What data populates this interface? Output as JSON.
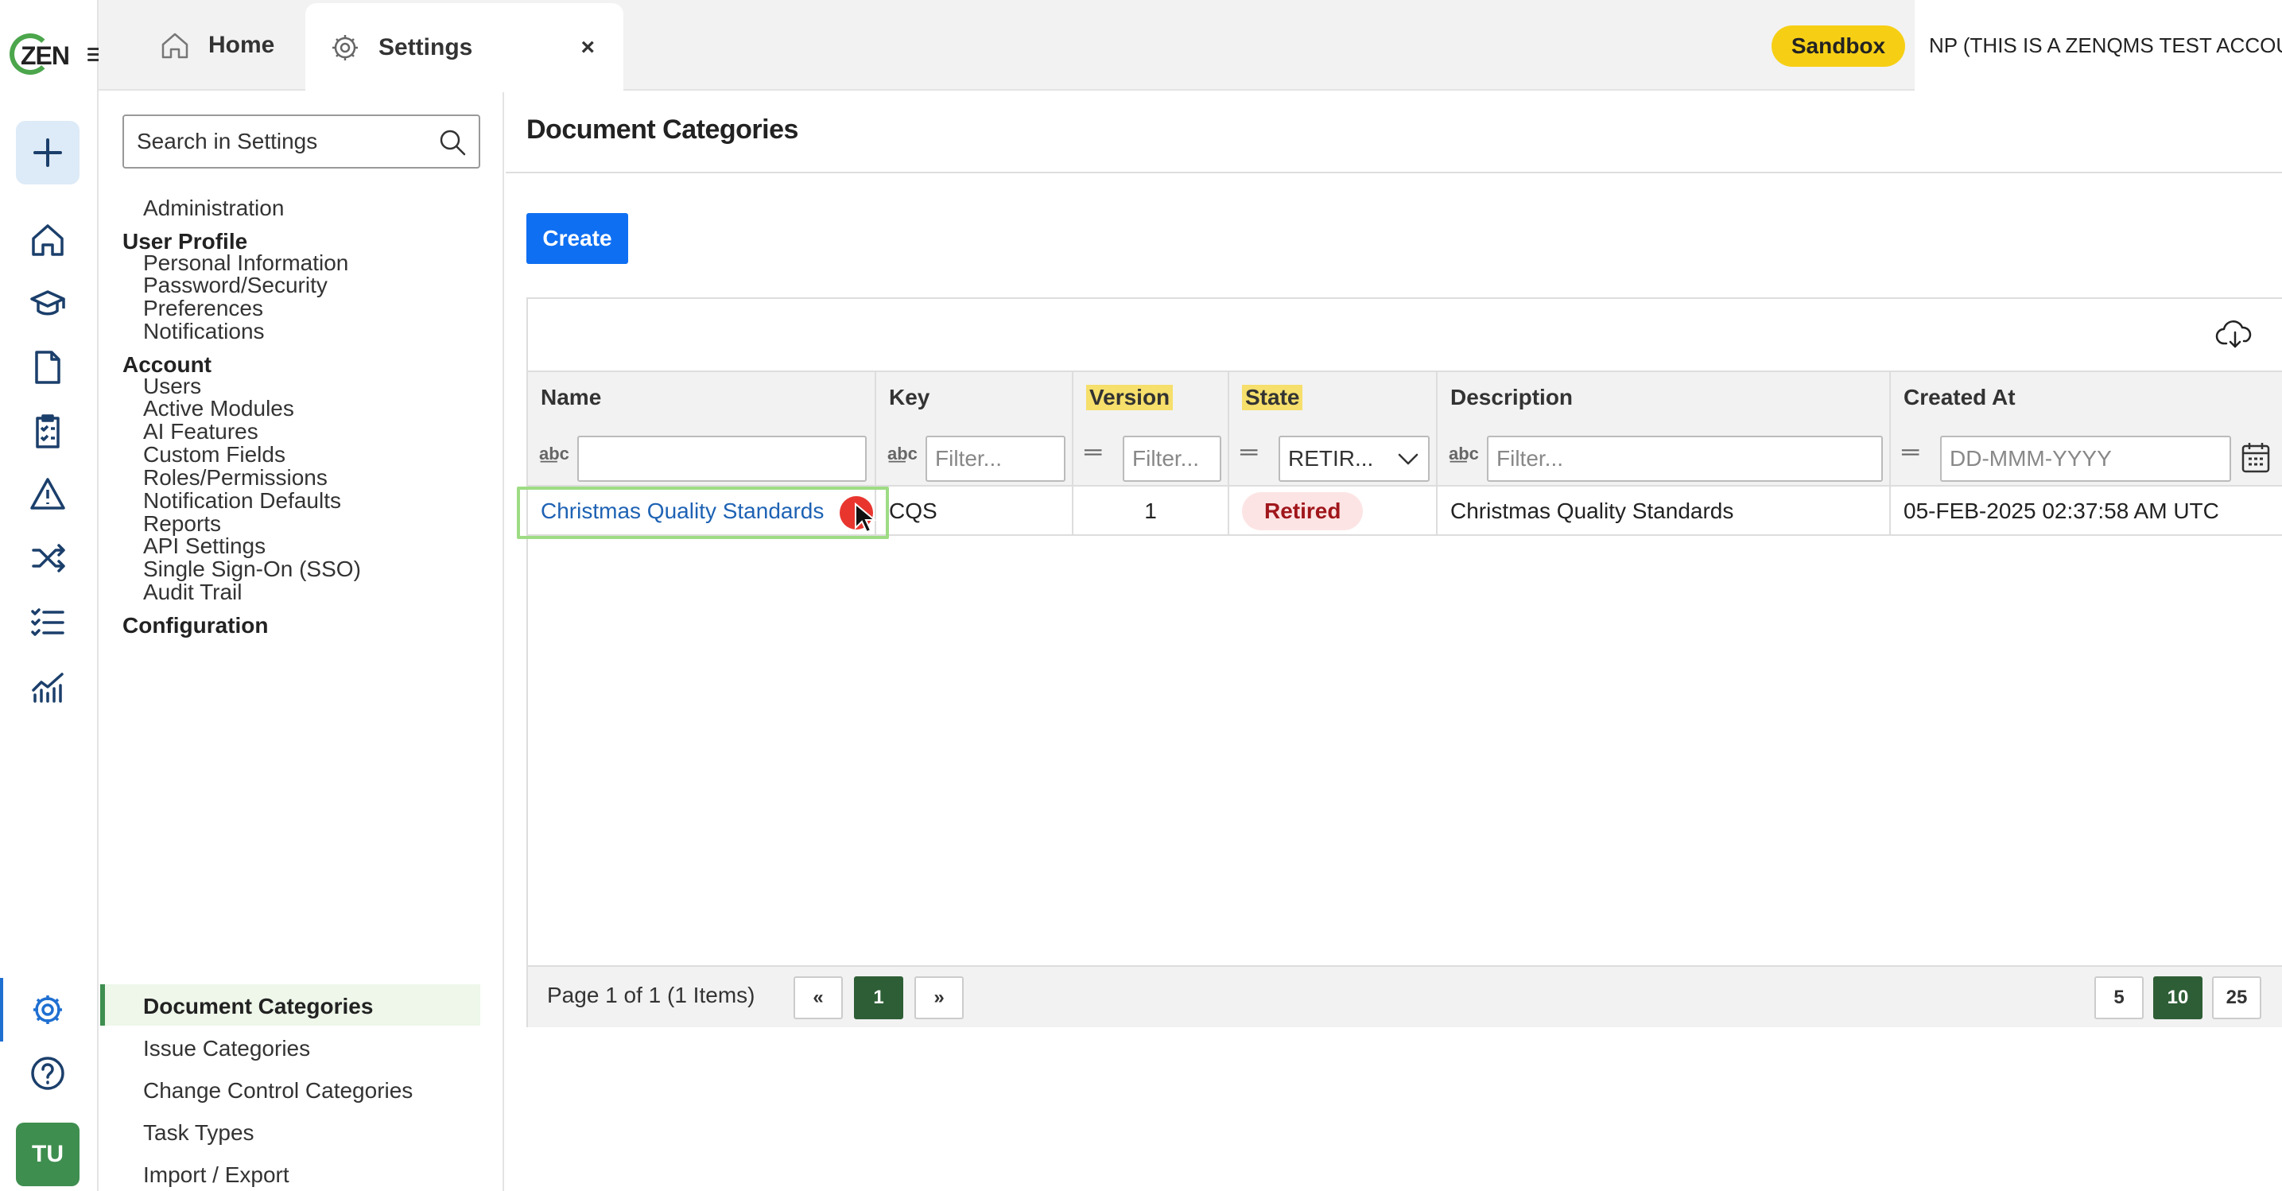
{
  "logo": {
    "text": "ZEN"
  },
  "tabs": [
    {
      "label": "Home",
      "icon": "home-icon"
    },
    {
      "label": "Settings",
      "icon": "gear-icon",
      "close": "×"
    }
  ],
  "header": {
    "sandbox_label": "Sandbox",
    "account_label": "NP (THIS IS A ZENQMS TEST ACCOUNT)"
  },
  "rail": {
    "icons": [
      "plus-icon",
      "home-icon",
      "training-icon",
      "document-icon",
      "checklist-icon",
      "warning-icon",
      "shuffle-icon",
      "tasks-icon",
      "analytics-icon",
      "gear-icon",
      "help-icon"
    ],
    "avatar_initials": "TU"
  },
  "settings_nav": {
    "search_placeholder": "Search in Settings",
    "top_item": "Administration",
    "sections": [
      {
        "heading": "User Profile",
        "items": [
          "Personal Information",
          "Password/Security",
          "Preferences",
          "Notifications"
        ]
      },
      {
        "heading": "Account",
        "items": [
          "Users",
          "Active Modules",
          "AI Features",
          "Custom Fields",
          "Roles/Permissions",
          "Notification Defaults",
          "Reports",
          "API Settings",
          "Single Sign-On (SSO)",
          "Audit Trail"
        ]
      },
      {
        "heading": "Configuration",
        "items": [
          "Document Categories",
          "Issue Categories",
          "Change Control Categories",
          "Task Types",
          "Import / Export"
        ]
      }
    ],
    "active_item": "Document Categories"
  },
  "main": {
    "title": "Document Categories",
    "create_label": "Create",
    "columns": [
      "Name",
      "Key",
      "Version",
      "State",
      "Description",
      "Created At"
    ],
    "filters": {
      "name": "",
      "key_placeholder": "Filter...",
      "version_placeholder": "Filter...",
      "state_value": "RETIR...",
      "description_placeholder": "Filter...",
      "created_placeholder": "DD-MMM-YYYY"
    },
    "rows": [
      {
        "name": "Christmas Quality Standards",
        "key": "CQS",
        "version": "1",
        "state": "Retired",
        "description": "Christmas Quality Standards",
        "created_at": "05-FEB-2025 02:37:58 AM UTC"
      }
    ],
    "pagination": {
      "info": "Page 1 of 1 (1 Items)",
      "prev": "«",
      "current": "1",
      "next": "»",
      "page_sizes": [
        "5",
        "10",
        "25"
      ],
      "selected_size": "10"
    }
  },
  "colors": {
    "accent": "#0f6ff2",
    "brand_green": "#3e8e4f",
    "highlight": "#f6df6b",
    "retired": "#a0161b"
  }
}
